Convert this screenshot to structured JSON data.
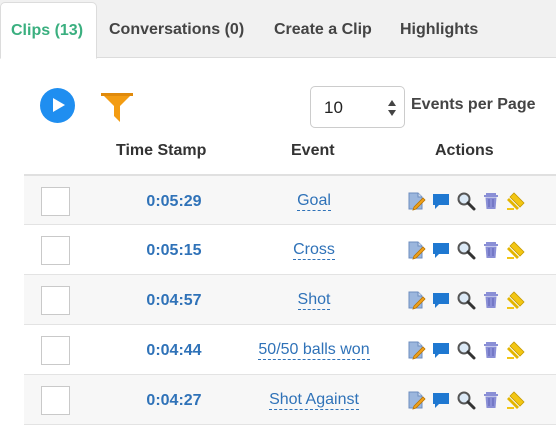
{
  "tabs": [
    {
      "label": "Clips (13)",
      "active": true
    },
    {
      "label": "Conversations (0)",
      "active": false
    },
    {
      "label": "Create a Clip",
      "active": false
    },
    {
      "label": "Highlights",
      "active": false
    }
  ],
  "toolbar": {
    "play_icon": "play-icon",
    "filter_icon": "filter-icon",
    "events_per_page_value": "10",
    "events_per_page_label": "Events per Page"
  },
  "table": {
    "headers": {
      "timestamp": "Time Stamp",
      "event": "Event",
      "actions": "Actions"
    },
    "rows": [
      {
        "timestamp": "0:05:29",
        "event": "Goal"
      },
      {
        "timestamp": "0:05:15",
        "event": "Cross"
      },
      {
        "timestamp": "0:04:57",
        "event": "Shot"
      },
      {
        "timestamp": "0:04:44",
        "event": "50/50 balls won"
      },
      {
        "timestamp": "0:04:27",
        "event": "Shot Against"
      }
    ],
    "action_icons": [
      "edit-icon",
      "comment-icon",
      "search-icon",
      "trash-icon",
      "highlighter-icon"
    ]
  },
  "colors": {
    "accent": "#3aaf7f",
    "link": "#2f72b8",
    "play": "#1f8ef0",
    "filter": "#f39c12"
  }
}
